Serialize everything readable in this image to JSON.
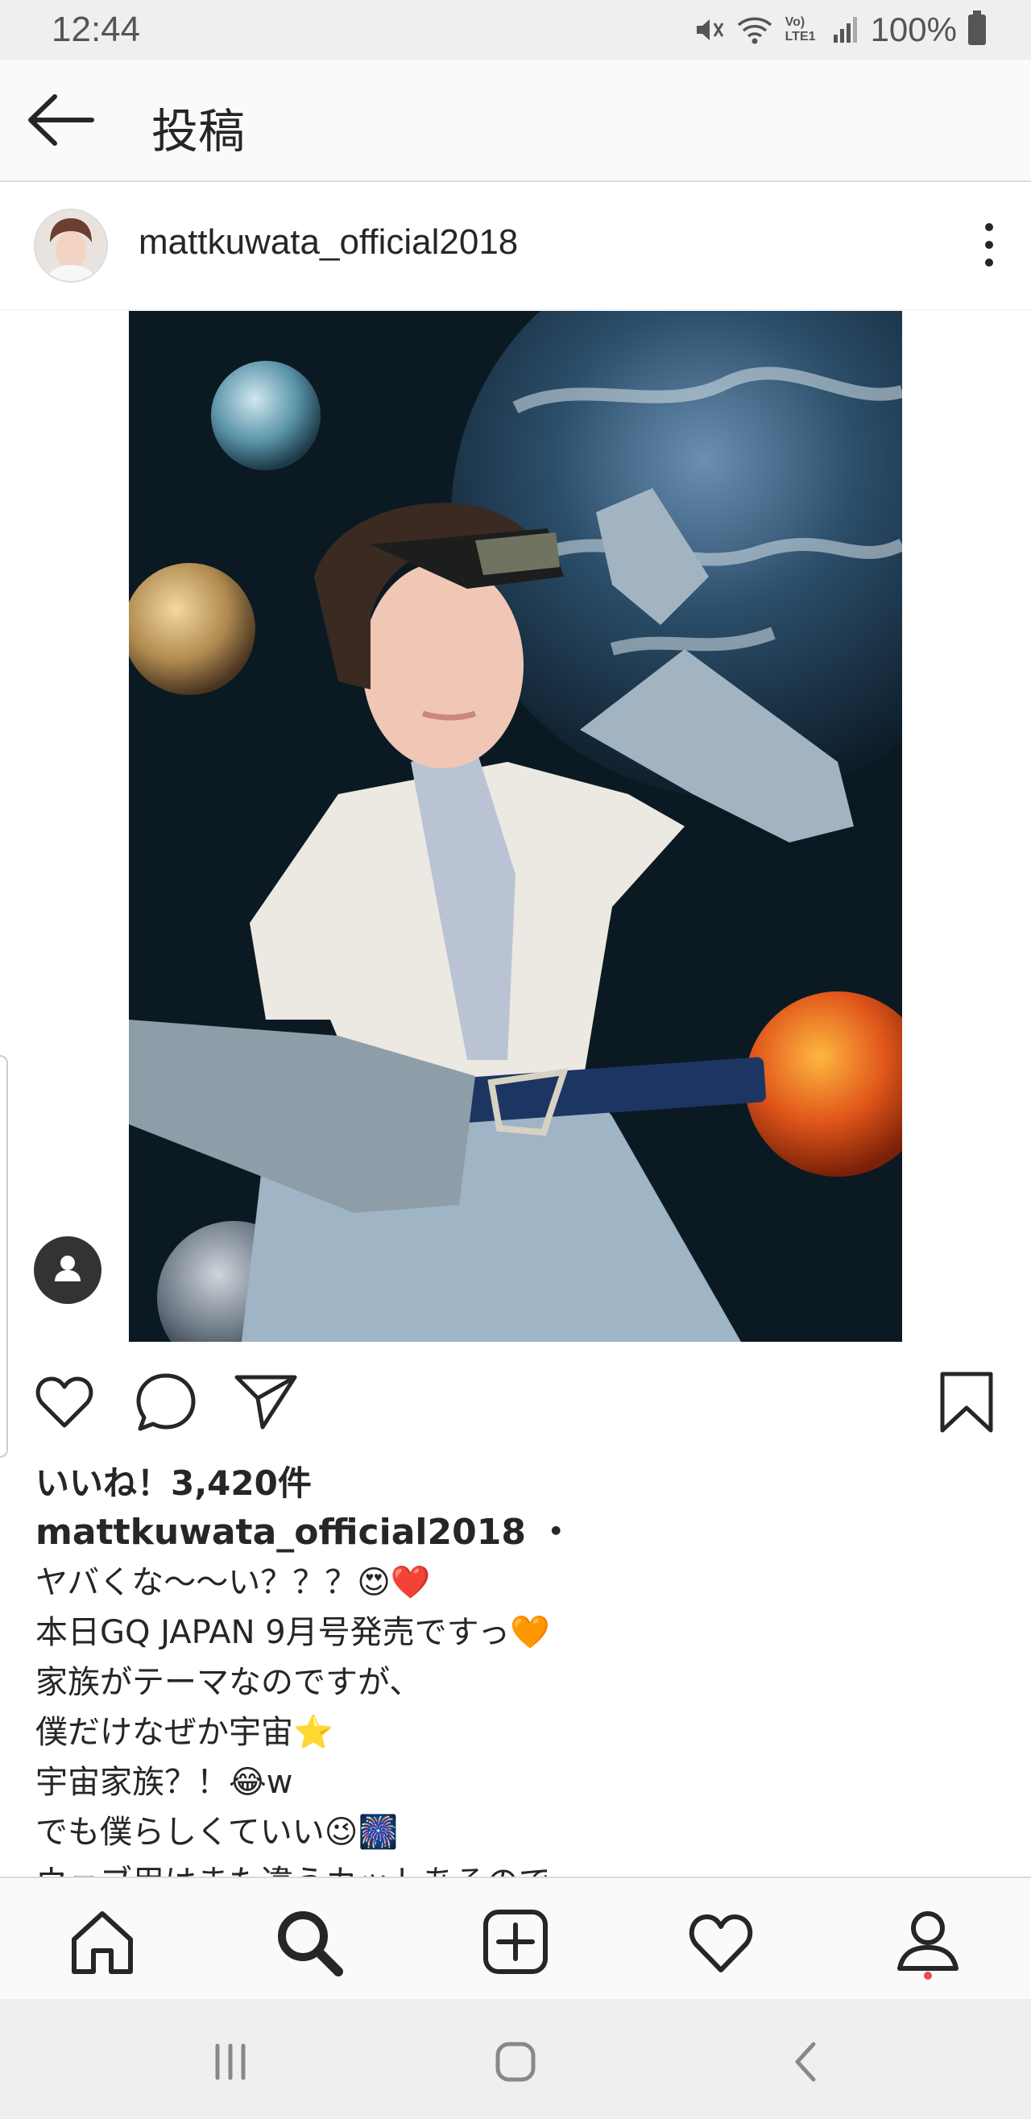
{
  "status_bar": {
    "time": "12:44",
    "battery": "100%",
    "network": "Vo) LTE1"
  },
  "header": {
    "title": "投稿"
  },
  "post": {
    "username": "mattkuwata_official2018",
    "likes": "いいね！3,420件",
    "caption_user": "mattkuwata_official2018 ・",
    "caption_lines": [
      "ヤバくな〜〜い？？？😍❤️",
      "本日GQ JAPAN 9月号発売ですっ🧡",
      "家族がテーマなのですが、",
      "僕だけなぜか宇宙⭐",
      "宇宙家族？！😂w",
      "でも僕らしくていい😉🎆",
      "ウェブ用はまた違うカットあるので"
    ]
  },
  "icons": {
    "back": "arrow-left-icon",
    "more": "more-vertical-icon",
    "like": "heart-icon",
    "comment": "comment-icon",
    "share": "send-icon",
    "save": "bookmark-icon",
    "home": "home-icon",
    "search": "search-icon",
    "add": "add-post-icon",
    "activity": "heart-icon",
    "profile": "profile-icon"
  },
  "colors": {
    "text": "#262626",
    "notification_dot": "#ed4956",
    "bar_bg": "#efefef"
  }
}
